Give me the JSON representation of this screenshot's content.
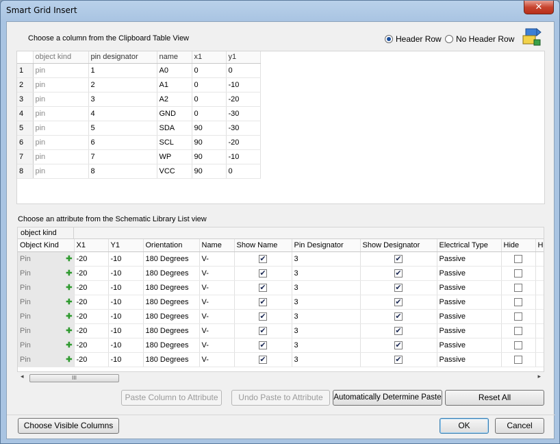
{
  "window": {
    "title": "Smart Grid Insert",
    "close_icon": "close-icon"
  },
  "top_section": {
    "label": "Choose a column from the Clipboard Table View",
    "header_row_label": "Header Row",
    "no_header_row_label": "No Header Row",
    "header_row_checked": true
  },
  "clipboard_table": {
    "columns": [
      "object kind",
      "pin designator",
      "name",
      "x1",
      "y1"
    ],
    "rows": [
      {
        "num": "1",
        "kind": "pin",
        "designator": "1",
        "name": "A0",
        "x1": "0",
        "y1": "0"
      },
      {
        "num": "2",
        "kind": "pin",
        "designator": "2",
        "name": "A1",
        "x1": "0",
        "y1": "-10"
      },
      {
        "num": "3",
        "kind": "pin",
        "designator": "3",
        "name": "A2",
        "x1": "0",
        "y1": "-20"
      },
      {
        "num": "4",
        "kind": "pin",
        "designator": "4",
        "name": "GND",
        "x1": "0",
        "y1": "-30"
      },
      {
        "num": "5",
        "kind": "pin",
        "designator": "5",
        "name": "SDA",
        "x1": "90",
        "y1": "-30"
      },
      {
        "num": "6",
        "kind": "pin",
        "designator": "6",
        "name": "SCL",
        "x1": "90",
        "y1": "-20"
      },
      {
        "num": "7",
        "kind": "pin",
        "designator": "7",
        "name": "WP",
        "x1": "90",
        "y1": "-10"
      },
      {
        "num": "8",
        "kind": "pin",
        "designator": "8",
        "name": "VCC",
        "x1": "90",
        "y1": "0"
      }
    ]
  },
  "bottom_section": {
    "label": "Choose an attribute from the Schematic Library List view",
    "group_label": "object kind",
    "columns": [
      "Object Kind",
      "X1",
      "Y1",
      "Orientation",
      "Name",
      "Show Name",
      "Pin Designator",
      "Show Designator",
      "Electrical Type",
      "Hide",
      "Hi"
    ],
    "rows": [
      {
        "kind": "Pin",
        "x1": "-20",
        "y1": "-10",
        "orientation": "180 Degrees",
        "name": "V-",
        "show_name": true,
        "designator": "3",
        "show_designator": true,
        "type": "Passive",
        "hide": false
      },
      {
        "kind": "Pin",
        "x1": "-20",
        "y1": "-10",
        "orientation": "180 Degrees",
        "name": "V-",
        "show_name": true,
        "designator": "3",
        "show_designator": true,
        "type": "Passive",
        "hide": false
      },
      {
        "kind": "Pin",
        "x1": "-20",
        "y1": "-10",
        "orientation": "180 Degrees",
        "name": "V-",
        "show_name": true,
        "designator": "3",
        "show_designator": true,
        "type": "Passive",
        "hide": false
      },
      {
        "kind": "Pin",
        "x1": "-20",
        "y1": "-10",
        "orientation": "180 Degrees",
        "name": "V-",
        "show_name": true,
        "designator": "3",
        "show_designator": true,
        "type": "Passive",
        "hide": false
      },
      {
        "kind": "Pin",
        "x1": "-20",
        "y1": "-10",
        "orientation": "180 Degrees",
        "name": "V-",
        "show_name": true,
        "designator": "3",
        "show_designator": true,
        "type": "Passive",
        "hide": false
      },
      {
        "kind": "Pin",
        "x1": "-20",
        "y1": "-10",
        "orientation": "180 Degrees",
        "name": "V-",
        "show_name": true,
        "designator": "3",
        "show_designator": true,
        "type": "Passive",
        "hide": false
      },
      {
        "kind": "Pin",
        "x1": "-20",
        "y1": "-10",
        "orientation": "180 Degrees",
        "name": "V-",
        "show_name": true,
        "designator": "3",
        "show_designator": true,
        "type": "Passive",
        "hide": false
      },
      {
        "kind": "Pin",
        "x1": "-20",
        "y1": "-10",
        "orientation": "180 Degrees",
        "name": "V-",
        "show_name": true,
        "designator": "3",
        "show_designator": true,
        "type": "Passive",
        "hide": false
      }
    ],
    "scroll_thumb": "III"
  },
  "buttons": {
    "paste_column": "Paste Column to Attribute",
    "undo_paste": "Undo Paste to Attribute",
    "auto_determine": "Automatically Determine Paste",
    "reset_all": "Reset All",
    "choose_columns": "Choose Visible Columns",
    "ok": "OK",
    "cancel": "Cancel"
  },
  "colors": {
    "title_bar": "#a9c4e2",
    "close_button": "#c7442f",
    "dialog_bg": "#f0f0f0",
    "plus_green": "#2f9a2f"
  }
}
